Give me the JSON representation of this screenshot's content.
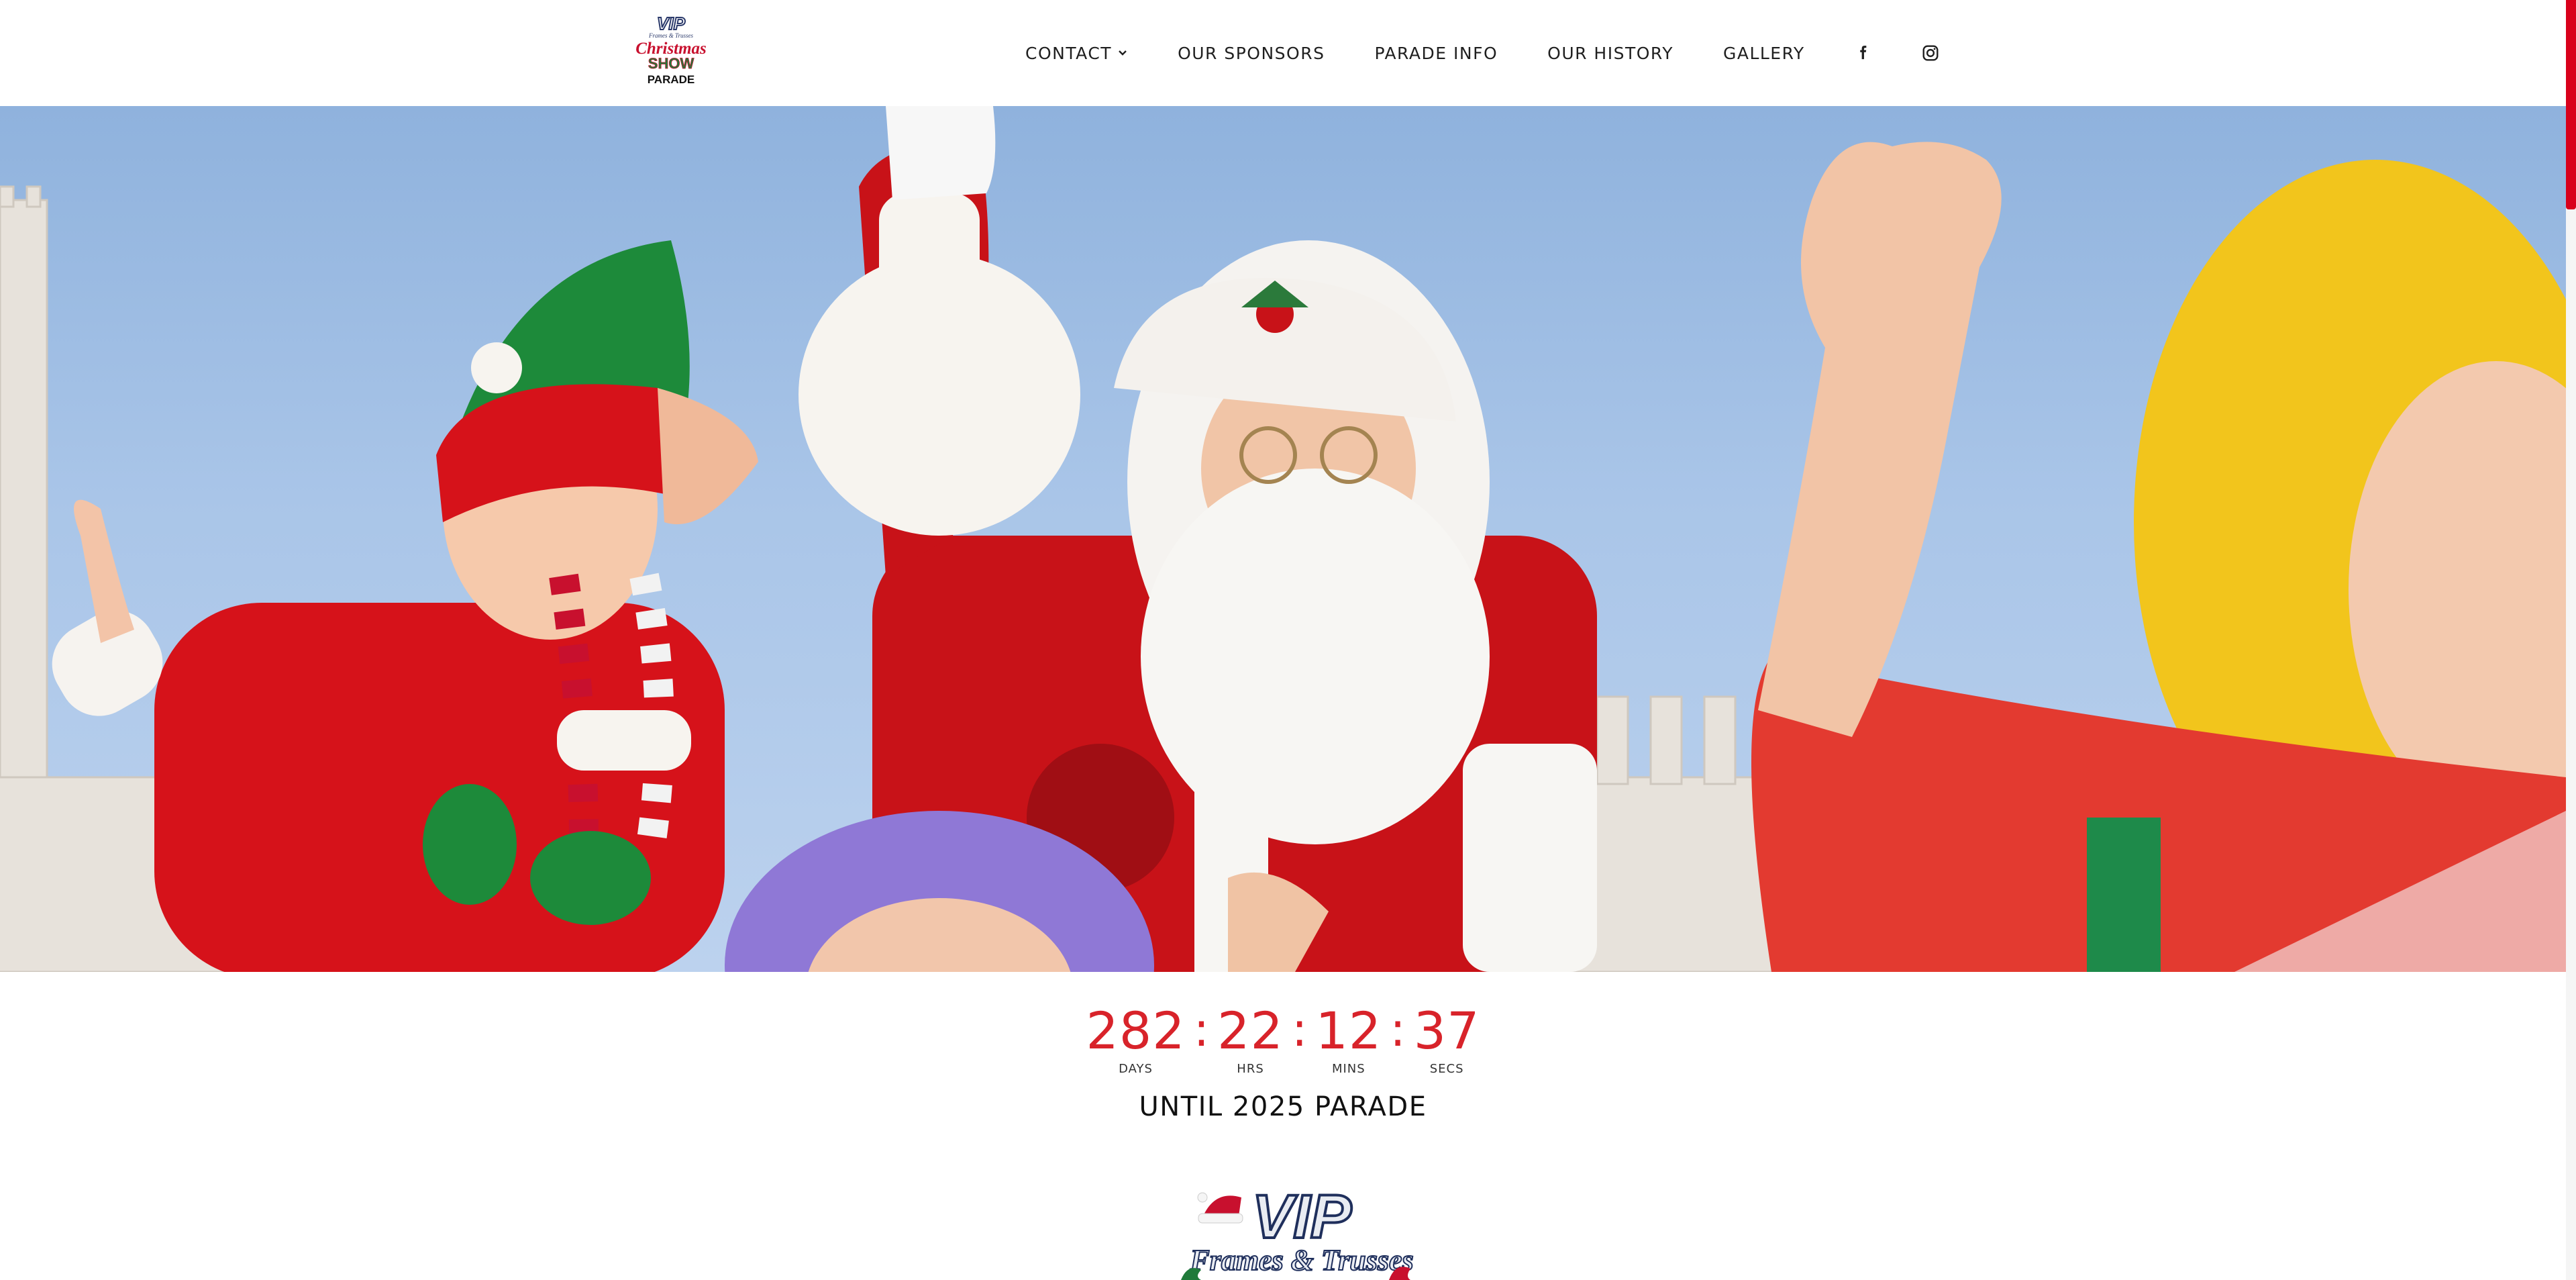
{
  "header": {
    "logo": {
      "lines": [
        "VIP",
        "Frames & Trusses",
        "Christmas",
        "SHOW",
        "PARADE"
      ]
    },
    "nav": [
      {
        "label": "CONTACT",
        "has_dropdown": true
      },
      {
        "label": "OUR SPONSORS"
      },
      {
        "label": "PARADE INFO"
      },
      {
        "label": "OUR HISTORY"
      },
      {
        "label": "GALLERY"
      }
    ],
    "social": [
      "facebook-icon",
      "instagram-icon"
    ]
  },
  "countdown": {
    "days": "282",
    "hours": "22",
    "mins": "12",
    "secs": "37",
    "separator": ":",
    "labels": {
      "days": "DAYS",
      "hours": "HRS",
      "mins": "MINS",
      "secs": "SECS"
    },
    "caption": "UNTIL 2025 PARADE"
  },
  "sponsor": {
    "lines": [
      "VIP",
      "Frames & Trusses"
    ]
  },
  "colors": {
    "accent": "#d8232a",
    "scroll_thumb": "#d9001b",
    "sky": "#a9c5e8"
  }
}
